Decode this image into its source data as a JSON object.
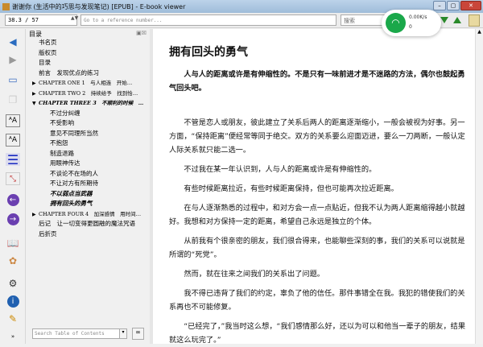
{
  "window": {
    "title": "谢谢你 (生活中的巧思与发现笔记) [EPUB] - E-book viewer",
    "minimize": "–",
    "maximize": "▢",
    "close": "✕"
  },
  "toolbar": {
    "position": "38.3 / 57",
    "reference_placeholder": "Go to a reference number...",
    "search_placeholder": "搜索"
  },
  "network": {
    "speed": "0.00K/s",
    "count": "0"
  },
  "toc": {
    "header": "目录",
    "items": [
      {
        "label": "书名页",
        "level": 0
      },
      {
        "label": "版权页",
        "level": 0
      },
      {
        "label": "目录",
        "level": 0
      },
      {
        "label": "前言　发现优点的练习",
        "level": 0
      },
      {
        "label": "CHAPTER ONE 1　与人相连　开始…",
        "level": 1,
        "arrow": "▶"
      },
      {
        "label": "CHAPTER TWO 2　持续给予　找到恰…",
        "level": 1,
        "arrow": "▶"
      },
      {
        "label": "CHAPTER THREE 3　不顺利的时候　…",
        "level": 1,
        "arrow": "▼",
        "bold": true
      },
      {
        "label": "不过分纠缠",
        "level": 2
      },
      {
        "label": "不受影响",
        "level": 2
      },
      {
        "label": "意见不同理所当然",
        "level": 2
      },
      {
        "label": "不抱怨",
        "level": 2
      },
      {
        "label": "制造退路",
        "level": 2
      },
      {
        "label": "用眼神传达",
        "level": 2
      },
      {
        "label": "不谈论不在场的人",
        "level": 2
      },
      {
        "label": "不让对方有所期待",
        "level": 2
      },
      {
        "label": "不以弱点当武器",
        "level": 2,
        "bold": true
      },
      {
        "label": "拥有回头的勇气",
        "level": 2,
        "bold": true
      },
      {
        "label": "CHAPTER FOUR 4　加深感情　用时间…",
        "level": 1,
        "arrow": "▶"
      },
      {
        "label": "后记　让一切变得更圆融的魔法咒语",
        "level": 0
      },
      {
        "label": "后折页",
        "level": 0
      }
    ],
    "search_placeholder": "Search Table of Contents"
  },
  "content": {
    "title": "拥有回头的勇气",
    "lead": "人与人的距离或许是有伸缩性的。不是只有一味前进才是不迷路的方法，偶尔也鼓起勇气回头吧。",
    "paragraphs": [
      "不管是恋人或朋友，彼此建立了关系后两人的距离逐渐缩小，一般会被视为好事。另一方面，“保持距离”便经常等同于绝交。双方的关系要么迎面迈进，要么一刀两断，一般认定人际关系就只能二选一。",
      "不过我在某一年认识到，人与人的距离或许是有伸缩性的。",
      "有些时候距离拉近，有些时候距离保持，但也可能再次拉近距离。",
      "在与人逐渐熟悉的过程中，和对方会一点一点贴近，但我不认为两人距离缩得越小就越好。我想和对方保持一定的距离，希望自己永远是独立的个体。",
      "从前我有个很亲密的朋友，我们很合得来，也能聊些深刻的事，我们的关系可以说就是所谓的“死党”。",
      "然而，就在往来之间我们的关系出了问题。",
      "我不得已违背了我们的约定，辜负了他的信任。那件事错全在我。我犯的错使我们的关系再也不可能修复。",
      "“已经完了，”我当时这么想，“我们感情那么好，还以为可以和他当一辈子的朋友，结果就这么玩完了。”"
    ]
  }
}
